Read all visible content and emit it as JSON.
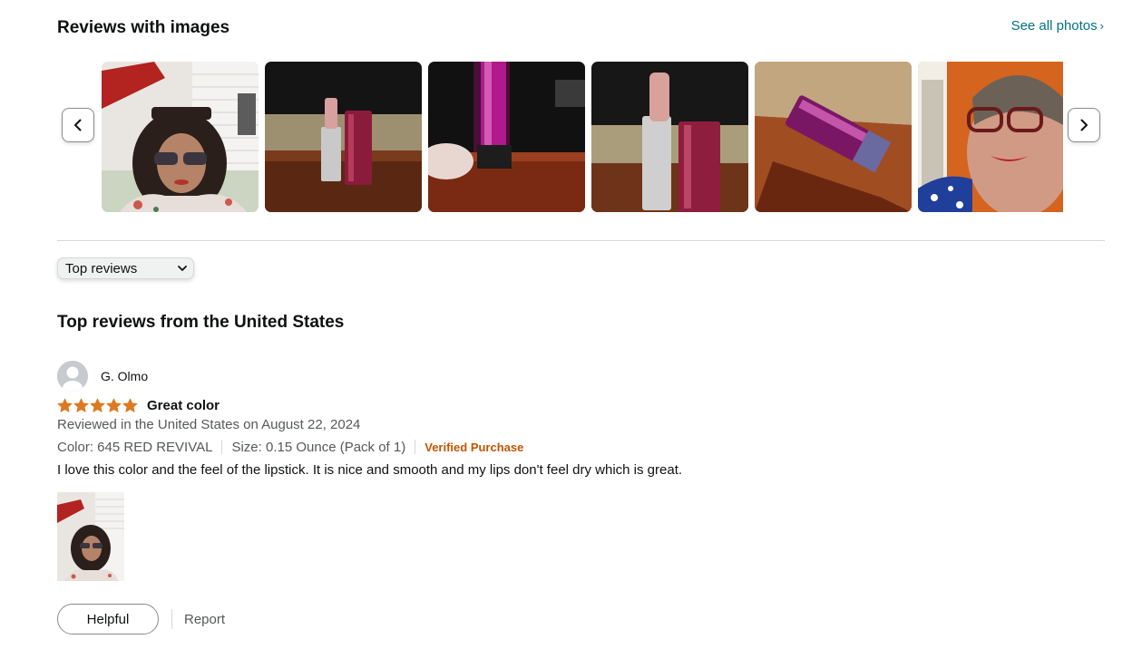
{
  "images_section": {
    "title": "Reviews with images",
    "see_all": "See all photos",
    "see_all_icon": "chevron-right-icon",
    "prev_icon": "chevron-left-icon",
    "next_icon": "chevron-right-icon"
  },
  "sort": {
    "selected": "Top reviews",
    "icon": "chevron-down-icon"
  },
  "region_title": "Top reviews from the United States",
  "review": {
    "reviewer": "G. Olmo",
    "rating": 5,
    "max_rating": 5,
    "title": "Great color",
    "date": "Reviewed in the United States on August 22, 2024",
    "color": "Color: 645 RED REVIVAL",
    "size": "Size: 0.15 Ounce (Pack of 1)",
    "verified": "Verified Purchase",
    "body": "I love this color and the feel of the lipstick. It is nice and smooth and my lips don't feel dry which is great.",
    "helpful": "Helpful",
    "report": "Report"
  },
  "colors": {
    "link": "#007185",
    "star": "#de7921",
    "verified": "#c45500",
    "muted_text": "#565959"
  }
}
